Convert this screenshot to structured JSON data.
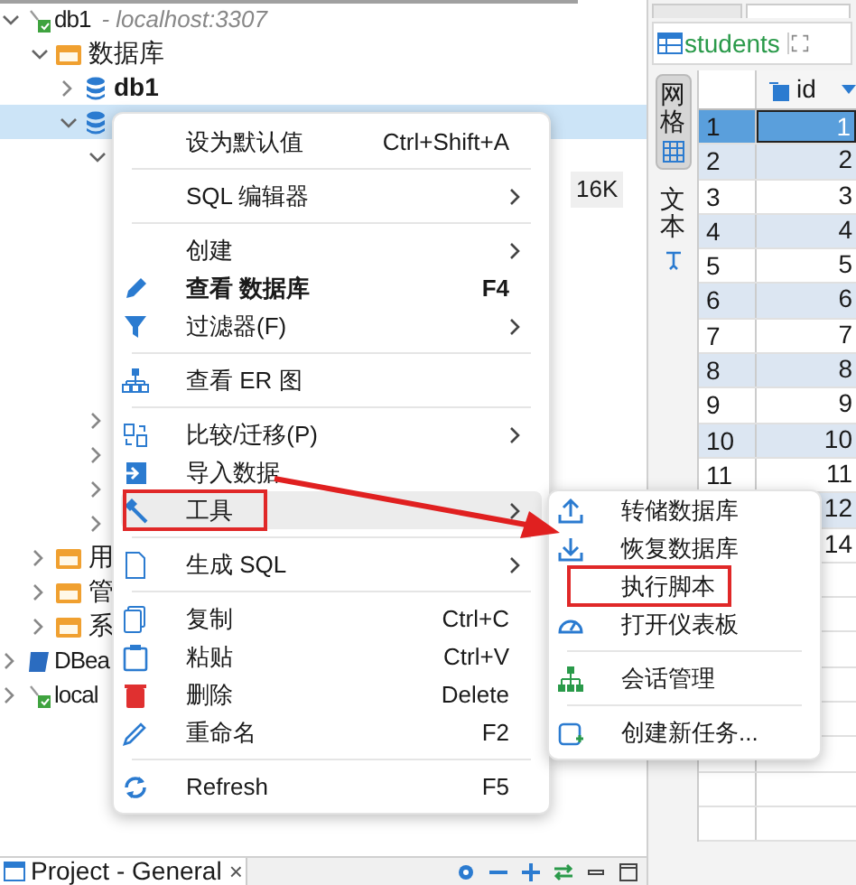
{
  "tree": [
    {
      "kind": "connection",
      "label": "db1",
      "suffix": "- localhost:3307",
      "expanded": true,
      "selected": false,
      "children": [
        {
          "kind": "folder",
          "label": "数据库",
          "expanded": true,
          "selected": false,
          "children": [
            {
              "kind": "database",
              "label": "db1",
              "bold": true,
              "expanded": false,
              "selected": false
            },
            {
              "kind": "database",
              "expanded": true,
              "selected": true,
              "children": [
                {
                  "expanded": true,
                  "selected": false
                },
                {
                  "expanded": false,
                  "selected": false
                },
                {
                  "expanded": false,
                  "selected": false
                },
                {
                  "expanded": false,
                  "selected": false
                },
                {
                  "expanded": false,
                  "selected": false
                }
              ]
            }
          ]
        },
        {
          "kind": "folder",
          "label": "用",
          "expanded": false,
          "selected": false
        },
        {
          "kind": "folder",
          "label": "管",
          "expanded": false,
          "selected": false
        },
        {
          "kind": "folder",
          "label": "系",
          "expanded": false,
          "selected": false
        }
      ]
    },
    {
      "kind": "project",
      "label": "DBea",
      "expanded": false,
      "selected": false
    },
    {
      "kind": "connection",
      "label": "local",
      "expanded": false,
      "selected": false
    }
  ],
  "size_badge": "16K",
  "context_menu": [
    {
      "kind": "item",
      "label": "设为默认值",
      "shortcut": "Ctrl+Shift+A"
    },
    {
      "kind": "separator"
    },
    {
      "kind": "item",
      "label": "SQL 编辑器",
      "submenu": true
    },
    {
      "kind": "separator"
    },
    {
      "kind": "item",
      "label": "创建",
      "submenu": true
    },
    {
      "kind": "item",
      "label": "查看 数据库",
      "shortcut": "F4",
      "bold": true
    },
    {
      "kind": "item",
      "label": "过滤器(F)",
      "submenu": true
    },
    {
      "kind": "separator"
    },
    {
      "kind": "item",
      "label": "查看 ER 图"
    },
    {
      "kind": "separator"
    },
    {
      "kind": "item",
      "label": "比较/迁移(P)",
      "submenu": true
    },
    {
      "kind": "item",
      "label": "导入数据"
    },
    {
      "kind": "item",
      "label": "工具",
      "submenu": true,
      "highlighted": true,
      "annotated": true
    },
    {
      "kind": "separator"
    },
    {
      "kind": "item",
      "label": "生成 SQL",
      "submenu": true
    },
    {
      "kind": "separator"
    },
    {
      "kind": "item",
      "label": "复制",
      "shortcut": "Ctrl+C"
    },
    {
      "kind": "item",
      "label": "粘贴",
      "shortcut": "Ctrl+V"
    },
    {
      "kind": "item",
      "label": "删除",
      "shortcut": "Delete"
    },
    {
      "kind": "item",
      "label": "重命名",
      "shortcut": "F2"
    },
    {
      "kind": "separator"
    },
    {
      "kind": "item",
      "label": "Refresh",
      "shortcut": "F5"
    }
  ],
  "submenu": [
    {
      "kind": "item",
      "label": "转储数据库"
    },
    {
      "kind": "item",
      "label": "恢复数据库"
    },
    {
      "kind": "item",
      "label": "执行脚本",
      "annotated": true
    },
    {
      "kind": "item",
      "label": "打开仪表板"
    },
    {
      "kind": "separator"
    },
    {
      "kind": "item",
      "label": "会话管理"
    },
    {
      "kind": "separator"
    },
    {
      "kind": "item",
      "label": "创建新任务..."
    }
  ],
  "editor": {
    "tab": "students",
    "side_tabs": [
      {
        "label": "网格",
        "selected": true
      },
      {
        "label": "文本",
        "selected": false
      }
    ],
    "column": "id",
    "rows": [
      {
        "number": "1",
        "id": "1",
        "selected": true
      },
      {
        "number": "2",
        "id": "2",
        "selected": false
      },
      {
        "number": "3",
        "id": "3",
        "selected": false
      },
      {
        "number": "4",
        "id": "4",
        "selected": false
      },
      {
        "number": "5",
        "id": "5",
        "selected": false
      },
      {
        "number": "6",
        "id": "6",
        "selected": false
      },
      {
        "number": "7",
        "id": "7",
        "selected": false
      },
      {
        "number": "8",
        "id": "8",
        "selected": false
      },
      {
        "number": "9",
        "id": "9",
        "selected": false
      },
      {
        "number": "10",
        "id": "10",
        "selected": false
      },
      {
        "number": "11",
        "id": "11",
        "selected": false
      },
      {
        "id": "12",
        "selected": false
      },
      {
        "id": "14",
        "selected": false
      }
    ]
  },
  "bottom_tab": {
    "label": "Project - General",
    "close": "×"
  }
}
